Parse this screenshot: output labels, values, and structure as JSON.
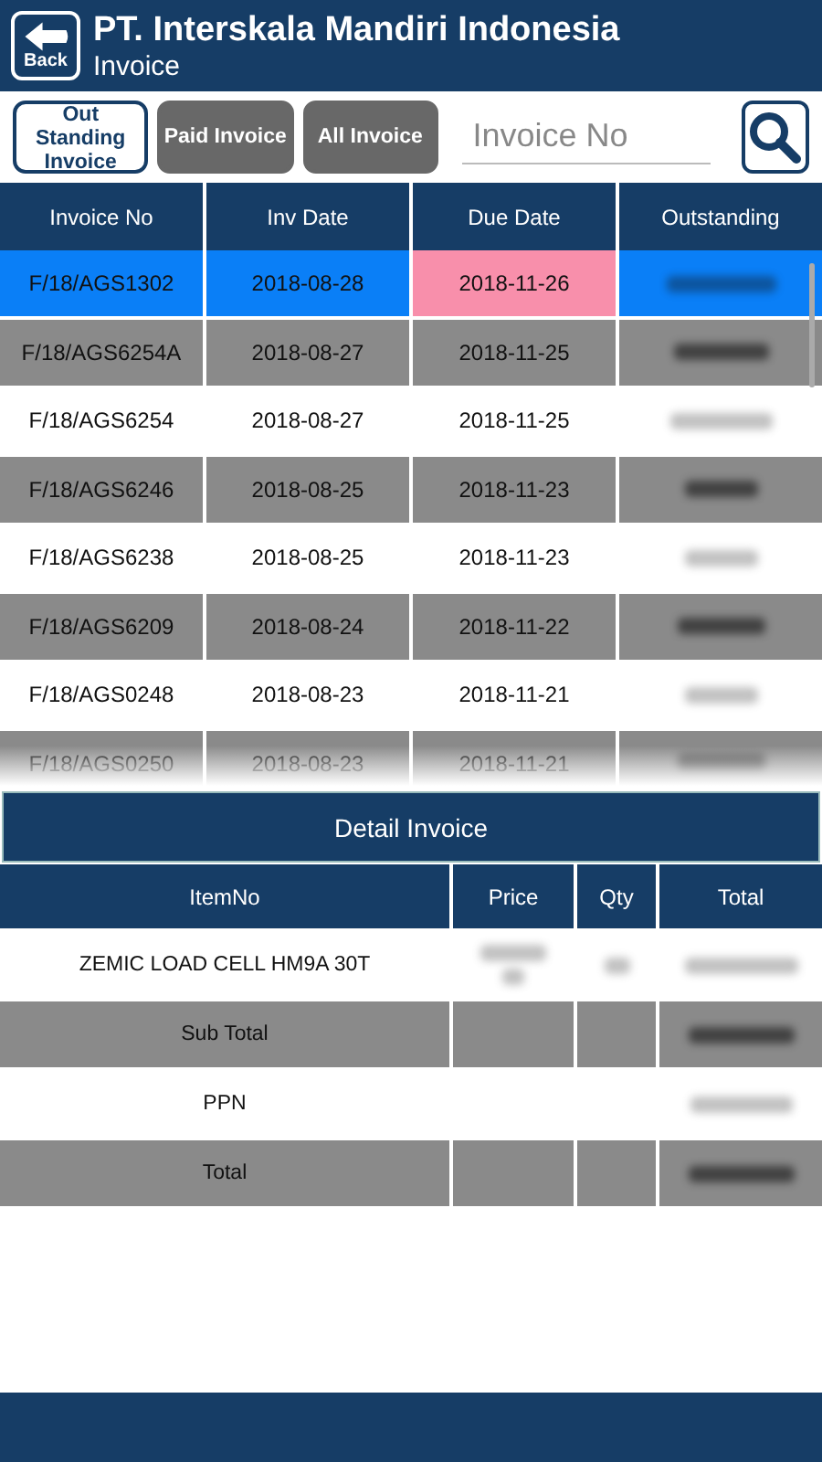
{
  "header": {
    "back_label": "Back",
    "title": "PT. Interskala Mandiri Indonesia",
    "subtitle": "Invoice"
  },
  "filters": [
    {
      "label": "Out Standing Invoice",
      "selected": true
    },
    {
      "label": "Paid Invoice",
      "selected": false
    },
    {
      "label": "All Invoice",
      "selected": false
    }
  ],
  "search": {
    "placeholder": "Invoice No"
  },
  "invoices": {
    "columns": [
      "Invoice No",
      "Inv Date",
      "Due Date",
      "Outstanding"
    ],
    "rows": [
      {
        "invoice_no": "F/18/AGS1302",
        "inv_date": "2018-08-28",
        "due_date": "2018-11-26",
        "selected": true
      },
      {
        "invoice_no": "F/18/AGS6254A",
        "inv_date": "2018-08-27",
        "due_date": "2018-11-25",
        "selected": false
      },
      {
        "invoice_no": "F/18/AGS6254",
        "inv_date": "2018-08-27",
        "due_date": "2018-11-25",
        "selected": false
      },
      {
        "invoice_no": "F/18/AGS6246",
        "inv_date": "2018-08-25",
        "due_date": "2018-11-23",
        "selected": false
      },
      {
        "invoice_no": "F/18/AGS6238",
        "inv_date": "2018-08-25",
        "due_date": "2018-11-23",
        "selected": false
      },
      {
        "invoice_no": "F/18/AGS6209",
        "inv_date": "2018-08-24",
        "due_date": "2018-11-22",
        "selected": false
      },
      {
        "invoice_no": "F/18/AGS0248",
        "inv_date": "2018-08-23",
        "due_date": "2018-11-21",
        "selected": false
      },
      {
        "invoice_no": "F/18/AGS0250",
        "inv_date": "2018-08-23",
        "due_date": "2018-11-21",
        "selected": false
      }
    ]
  },
  "detail": {
    "title": "Detail Invoice",
    "columns": [
      "ItemNo",
      "Price",
      "Qty",
      "Total"
    ],
    "rows": [
      {
        "kind": "item",
        "label": "ZEMIC LOAD CELL HM9A 30T"
      },
      {
        "kind": "summary",
        "label": "Sub Total"
      },
      {
        "kind": "tax",
        "label": "PPN"
      },
      {
        "kind": "summary",
        "label": "Total"
      }
    ]
  }
}
